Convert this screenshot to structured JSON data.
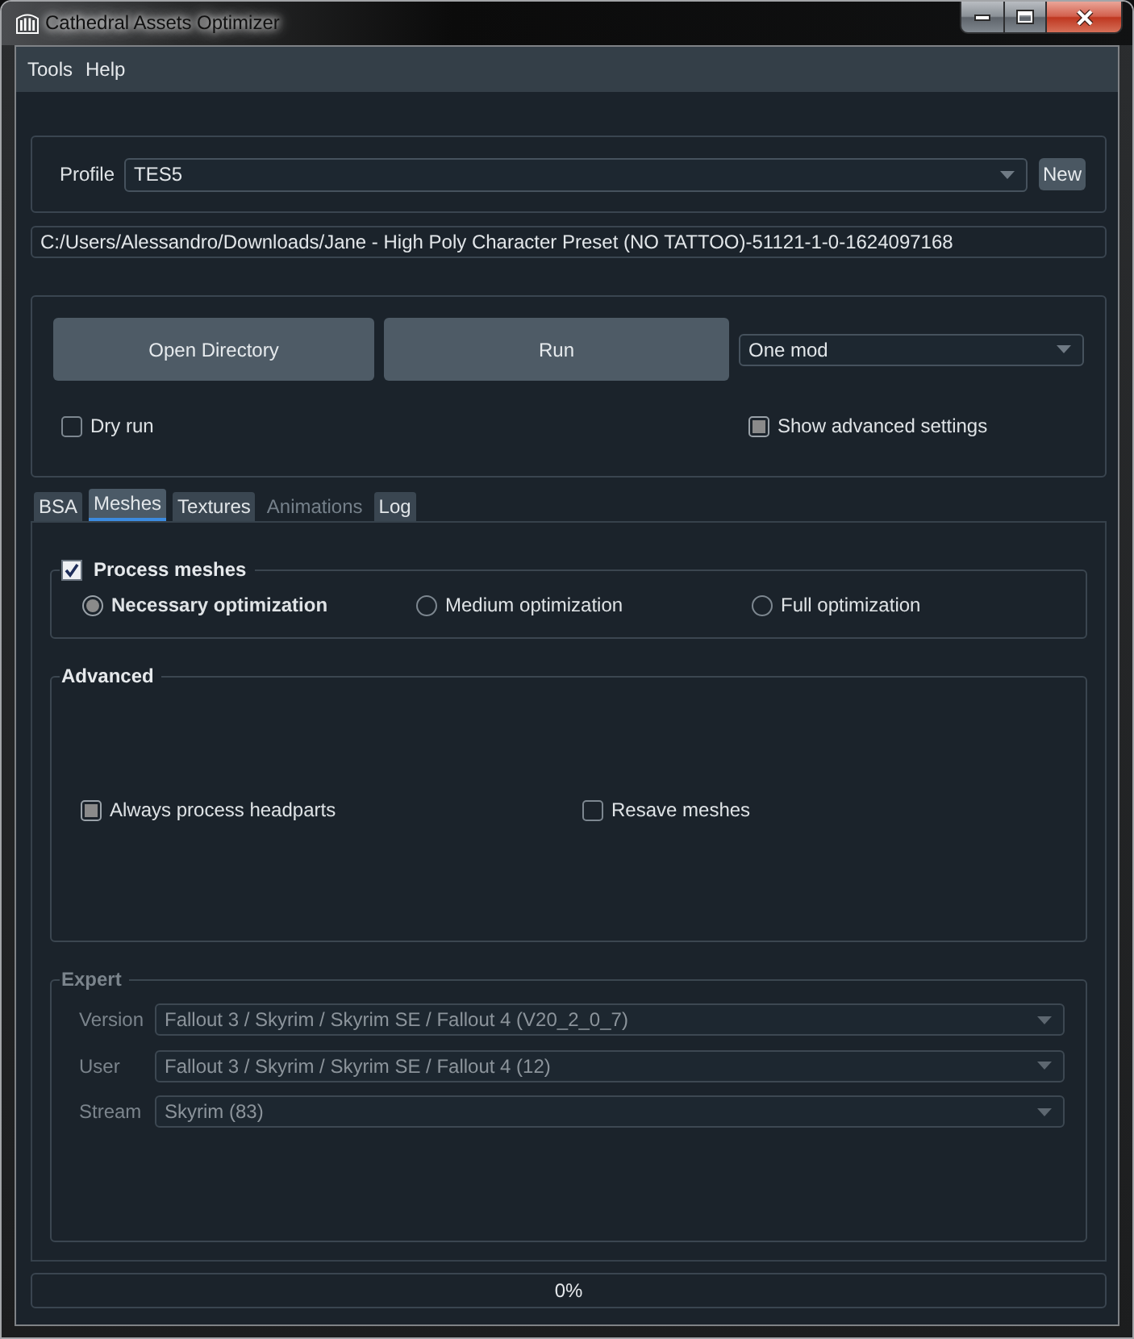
{
  "window": {
    "title": "Cathedral Assets Optimizer"
  },
  "menu": [
    "Tools",
    "Help"
  ],
  "profile": {
    "label": "Profile",
    "value": "TES5",
    "button": "New"
  },
  "path": {
    "value": "C:/Users/Alessandro/Downloads/Jane - High Poly Character Preset (NO TATTOO)-51121-1-0-1624097168"
  },
  "actions": {
    "buttons": [
      "Open Directory",
      "Run"
    ],
    "mode": {
      "value": "One mod"
    },
    "options": [
      {
        "label": "Dry run",
        "checked": false
      },
      {
        "label": "Show advanced settings",
        "checked": true
      }
    ]
  },
  "tabs": [
    {
      "label": "BSA",
      "selected": false,
      "disabled": false
    },
    {
      "label": "Meshes",
      "selected": true,
      "disabled": false
    },
    {
      "label": "Textures",
      "selected": false,
      "disabled": false
    },
    {
      "label": "Animations",
      "selected": false,
      "disabled": true
    },
    {
      "label": "Log",
      "selected": false,
      "disabled": false
    }
  ],
  "process_meshes": {
    "title": "Process meshes",
    "checked": true,
    "options": [
      {
        "label": "Necessary optimization",
        "selected": true
      },
      {
        "label": "Medium optimization",
        "selected": false
      },
      {
        "label": "Full optimization",
        "selected": false
      }
    ]
  },
  "advanced": {
    "title": "Advanced",
    "options": [
      {
        "label": "Always process headparts",
        "checked": true
      },
      {
        "label": "Resave meshes",
        "checked": false
      }
    ]
  },
  "expert": {
    "title": "Expert",
    "disabled": true,
    "fields": [
      {
        "label": "Version",
        "value": "Fallout 3 / Skyrim / Skyrim SE / Fallout 4 (V20_2_0_7)"
      },
      {
        "label": "User",
        "value": "Fallout 3 / Skyrim / Skyrim SE / Fallout 4 (12)"
      },
      {
        "label": "Stream",
        "value": "Skyrim (83)"
      }
    ]
  },
  "progress": {
    "level": 0,
    "text": "0%"
  }
}
